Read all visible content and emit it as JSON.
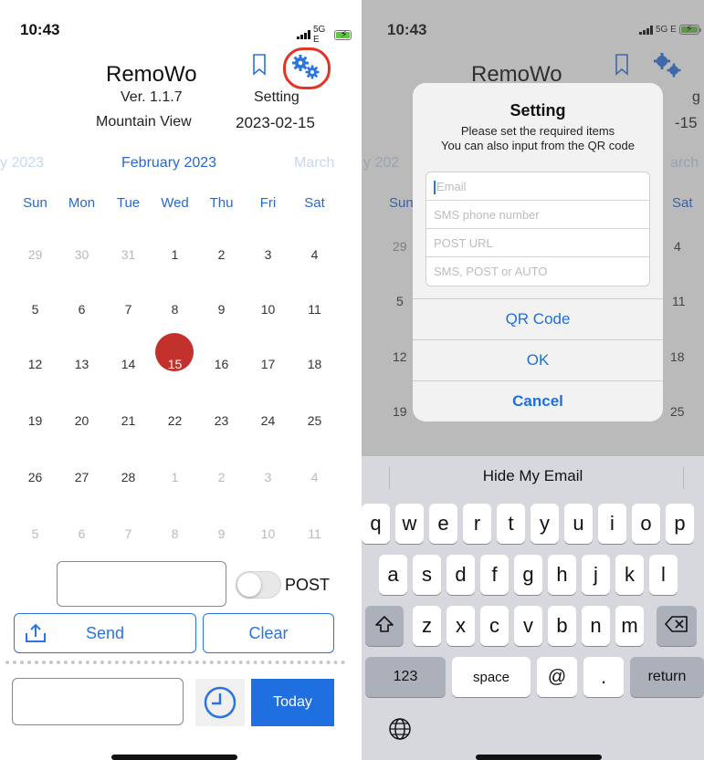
{
  "colors": {
    "accent": "#2668d6",
    "selected": "#c2312b",
    "today_button": "#1f6fe0",
    "highlight_ring": "#e53224"
  },
  "left": {
    "status": {
      "time": "10:43",
      "network": "5G E"
    },
    "app_title": "RemoWo",
    "version": "Ver. 1.1.7",
    "setting_label": "Setting",
    "location": "Mountain View",
    "date": "2023-02-15",
    "month_prev": "y 2023",
    "month_current": "February 2023",
    "month_next": "March",
    "weekdays": [
      "Sun",
      "Mon",
      "Tue",
      "Wed",
      "Thu",
      "Fri",
      "Sat"
    ],
    "weeks": [
      [
        "29",
        "30",
        "31",
        "1",
        "2",
        "3",
        "4"
      ],
      [
        "5",
        "6",
        "7",
        "8",
        "9",
        "10",
        "11"
      ],
      [
        "12",
        "13",
        "14",
        "15",
        "16",
        "17",
        "18"
      ],
      [
        "19",
        "20",
        "21",
        "22",
        "23",
        "24",
        "25"
      ],
      [
        "26",
        "27",
        "28",
        "1",
        "2",
        "3",
        "4"
      ],
      [
        "5",
        "6",
        "7",
        "8",
        "9",
        "10",
        "11"
      ]
    ],
    "post_label": "POST",
    "post_toggle_on": false,
    "send_label": "Send",
    "clear_label": "Clear",
    "today_label": "Today",
    "icons": {
      "bookmark": "bookmark-icon",
      "settings": "gears-icon",
      "send": "upload-tray-icon",
      "clock": "clock-icon"
    }
  },
  "right": {
    "status": {
      "time": "10:43",
      "network": "5G E"
    },
    "app_title": "RemoWo",
    "bg_setting_fragment": "g",
    "bg_date_fragment": "-15",
    "bg_month_prev": "y 202",
    "bg_month_next": "arch",
    "bg_sun": "Sun",
    "bg_sat": "Sat",
    "bg_rows": [
      [
        "29",
        "4"
      ],
      [
        "5",
        "11"
      ],
      [
        "12",
        "18"
      ],
      [
        "19",
        "25"
      ]
    ],
    "dialog": {
      "title": "Setting",
      "message_1": "Please set the required items",
      "message_2": "You can also input from the QR code",
      "fields": [
        {
          "placeholder": "Email"
        },
        {
          "placeholder": "SMS phone number"
        },
        {
          "placeholder": "POST URL"
        },
        {
          "placeholder": "SMS, POST or AUTO"
        }
      ],
      "qr_label": "QR Code",
      "ok_label": "OK",
      "cancel_label": "Cancel"
    },
    "keyboard": {
      "suggestion": "Hide My Email",
      "row1": [
        "q",
        "w",
        "e",
        "r",
        "t",
        "y",
        "u",
        "i",
        "o",
        "p"
      ],
      "row2": [
        "a",
        "s",
        "d",
        "f",
        "g",
        "h",
        "j",
        "k",
        "l"
      ],
      "row3": [
        "z",
        "x",
        "c",
        "v",
        "b",
        "n",
        "m"
      ],
      "numbers_label": "123",
      "space_label": "space",
      "at_label": "@",
      "dot_label": ".",
      "return_label": "return",
      "icons": {
        "shift": "shift-icon",
        "delete": "delete-icon",
        "globe": "globe-icon"
      }
    }
  }
}
